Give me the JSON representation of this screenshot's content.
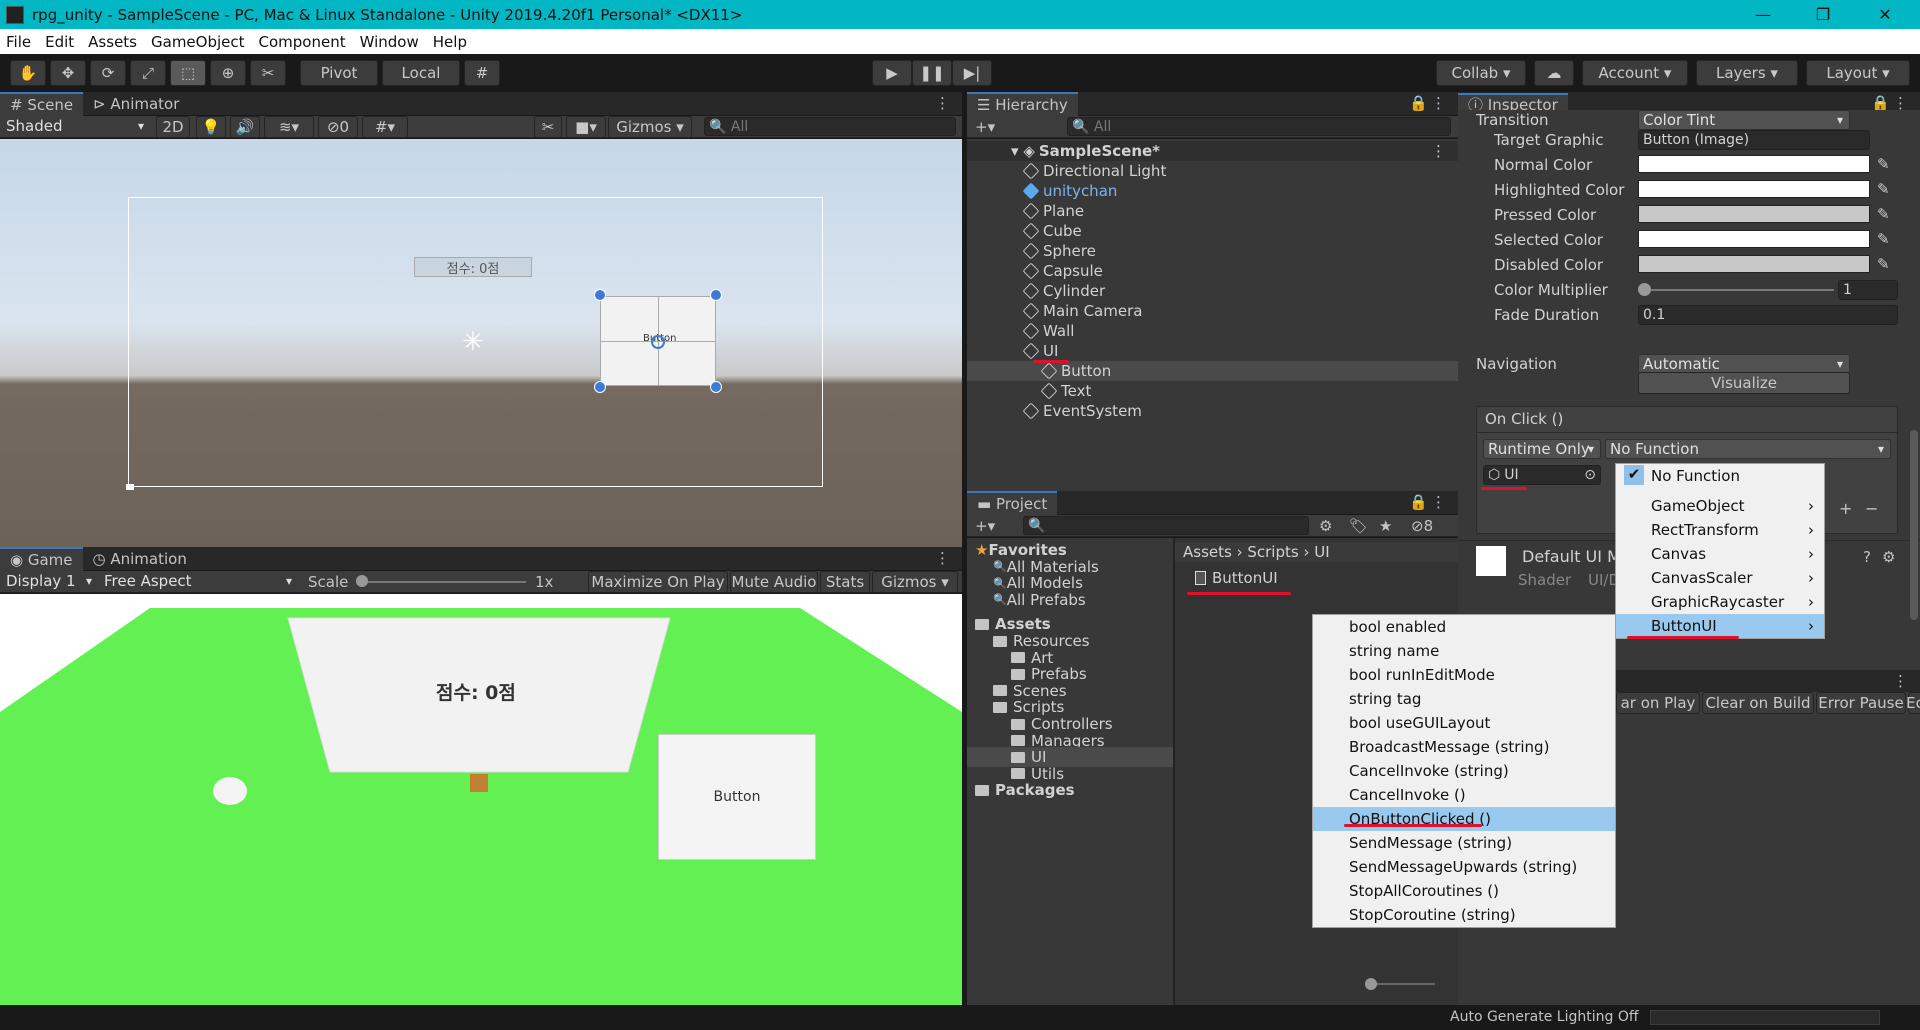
{
  "window": {
    "title": "rpg_unity - SampleScene - PC, Mac & Linux Standalone - Unity 2019.4.20f1 Personal* <DX11>",
    "min": "—",
    "max": "❐",
    "close": "✕"
  },
  "menubar": [
    "File",
    "Edit",
    "Assets",
    "GameObject",
    "Component",
    "Window",
    "Help"
  ],
  "toolbar": {
    "pivot": "Pivot",
    "local": "Local",
    "collab": "Collab",
    "account": "Account",
    "layers": "Layers",
    "layout": "Layout",
    "tools": [
      "hand",
      "move",
      "rotate",
      "scale",
      "rect",
      "transform",
      "custom"
    ]
  },
  "scene": {
    "tab": "Scene",
    "tab2": "Animator",
    "shading": "Shaded",
    "mode2d": "2D",
    "hidden_count": "0",
    "gizmos": "Gizmos",
    "search_placeholder": "All",
    "score_label": "점수: 0점",
    "button_label": "Button"
  },
  "game": {
    "tab": "Game",
    "tab2": "Animation",
    "display": "Display 1",
    "aspect": "Free Aspect",
    "scale_label": "Scale",
    "scale_value": "1x",
    "options": [
      "Maximize On Play",
      "Mute Audio",
      "Stats",
      "Gizmos"
    ],
    "score_label": "점수: 0점",
    "button_label": "Button"
  },
  "hierarchy": {
    "tab": "Hierarchy",
    "search_placeholder": "All",
    "scene": "SampleScene*",
    "items": [
      {
        "label": "Directional Light",
        "indent": 1
      },
      {
        "label": "unitychan",
        "indent": 1,
        "prefab": true
      },
      {
        "label": "Plane",
        "indent": 1
      },
      {
        "label": "Cube",
        "indent": 1
      },
      {
        "label": "Sphere",
        "indent": 1
      },
      {
        "label": "Capsule",
        "indent": 1
      },
      {
        "label": "Cylinder",
        "indent": 1
      },
      {
        "label": "Main Camera",
        "indent": 1
      },
      {
        "label": "Wall",
        "indent": 1
      },
      {
        "label": "UI",
        "indent": 1
      },
      {
        "label": "Button",
        "indent": 2
      },
      {
        "label": "Text",
        "indent": 2
      },
      {
        "label": "EventSystem",
        "indent": 1
      }
    ]
  },
  "project": {
    "tab": "Project",
    "hidden_count": "8",
    "breadcrumb": [
      "Assets",
      "Scripts",
      "UI"
    ],
    "file": "ButtonUI",
    "tree": [
      {
        "label": "Favorites",
        "indent": 0,
        "type": "star"
      },
      {
        "label": "All Materials",
        "indent": 1,
        "type": "search"
      },
      {
        "label": "All Models",
        "indent": 1,
        "type": "search"
      },
      {
        "label": "All Prefabs",
        "indent": 1,
        "type": "search"
      },
      {
        "label": "Assets",
        "indent": 0,
        "type": "folder"
      },
      {
        "label": "Resources",
        "indent": 1,
        "type": "folder"
      },
      {
        "label": "Art",
        "indent": 2,
        "type": "folder"
      },
      {
        "label": "Prefabs",
        "indent": 2,
        "type": "folder"
      },
      {
        "label": "Scenes",
        "indent": 1,
        "type": "folder"
      },
      {
        "label": "Scripts",
        "indent": 1,
        "type": "folder"
      },
      {
        "label": "Controllers",
        "indent": 2,
        "type": "folder"
      },
      {
        "label": "Managers",
        "indent": 2,
        "type": "folder"
      },
      {
        "label": "UI",
        "indent": 2,
        "type": "folder"
      },
      {
        "label": "Utils",
        "indent": 2,
        "type": "folder"
      },
      {
        "label": "Packages",
        "indent": 0,
        "type": "folder"
      }
    ]
  },
  "inspector": {
    "tab": "Inspector",
    "transition_label": "Transition",
    "transition_value": "Color Tint",
    "props": [
      {
        "label": "Target Graphic",
        "value": "Button (Image)"
      },
      {
        "label": "Normal Color",
        "value": ""
      },
      {
        "label": "Highlighted Color",
        "value": ""
      },
      {
        "label": "Pressed Color",
        "value": ""
      },
      {
        "label": "Selected Color",
        "value": ""
      },
      {
        "label": "Disabled Color",
        "value": ""
      },
      {
        "label": "Color Multiplier",
        "value": "1"
      },
      {
        "label": "Fade Duration",
        "value": "0.1"
      }
    ],
    "navigation_label": "Navigation",
    "navigation_value": "Automatic",
    "visualize": "Visualize",
    "onclick": "On Click ()",
    "runtime": "Runtime Only",
    "function": "No Function",
    "object": "UI",
    "material": "Default UI M",
    "shader_label": "Shader",
    "shader_value": "UI/D",
    "console_options": [
      "ar on Play",
      "Clear on Build",
      "Error Pause",
      "Ec"
    ]
  },
  "menu_component": {
    "items": [
      "No Function",
      "GameObject",
      "RectTransform",
      "Canvas",
      "CanvasScaler",
      "GraphicRaycaster",
      "ButtonUI"
    ],
    "checked": "No Function",
    "selected": "ButtonUI"
  },
  "menu_function": {
    "items": [
      "bool enabled",
      "string name",
      "bool runInEditMode",
      "string tag",
      "bool useGUILayout",
      "BroadcastMessage (string)",
      "CancelInvoke (string)",
      "CancelInvoke ()",
      "OnButtonClicked ()",
      "SendMessage (string)",
      "SendMessageUpwards (string)",
      "StopAllCoroutines ()",
      "StopCoroutine (string)"
    ],
    "selected": "OnButtonClicked ()"
  },
  "status": {
    "text": "Auto Generate Lighting Off"
  }
}
